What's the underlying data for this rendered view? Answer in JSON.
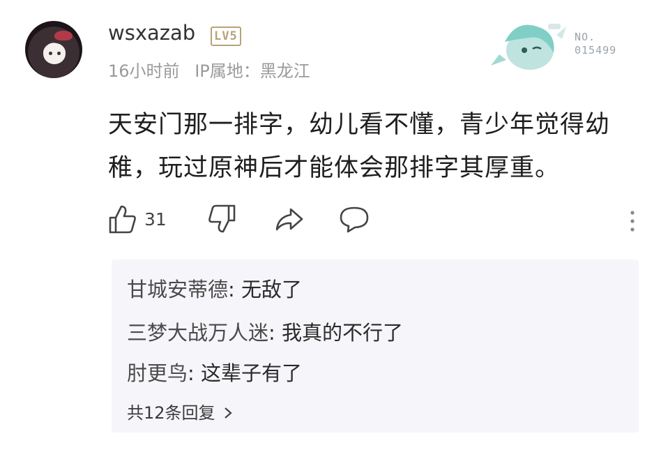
{
  "comment": {
    "username": "wsxazab",
    "level_badge": "LV5",
    "time": "16小时前",
    "ip_location": "IP属地：黑龙江",
    "decoration_number_label": "NO.",
    "decoration_number": "015499",
    "text": "天安门那一排字，幼儿看不懂，青少年觉得幼稚，玩过原神后才能体会那排字其厚重。",
    "like_count": "31"
  },
  "icons": [
    "avatar",
    "like-icon",
    "dislike-icon",
    "share-icon",
    "comment-icon",
    "more-icon",
    "chevron-right-icon"
  ],
  "replies": {
    "items": [
      {
        "author": "甘城安蒂德",
        "text": "无敌了"
      },
      {
        "author": "三梦大战万人迷",
        "text": "我真的不行了"
      },
      {
        "author": "肘更鸟",
        "text": "这辈子有了"
      }
    ],
    "more_label": "共12条回复"
  },
  "colors": {
    "badge": "#b8a27a",
    "meta": "#9a9a9a",
    "reply_bg": "#f6f6fa"
  }
}
